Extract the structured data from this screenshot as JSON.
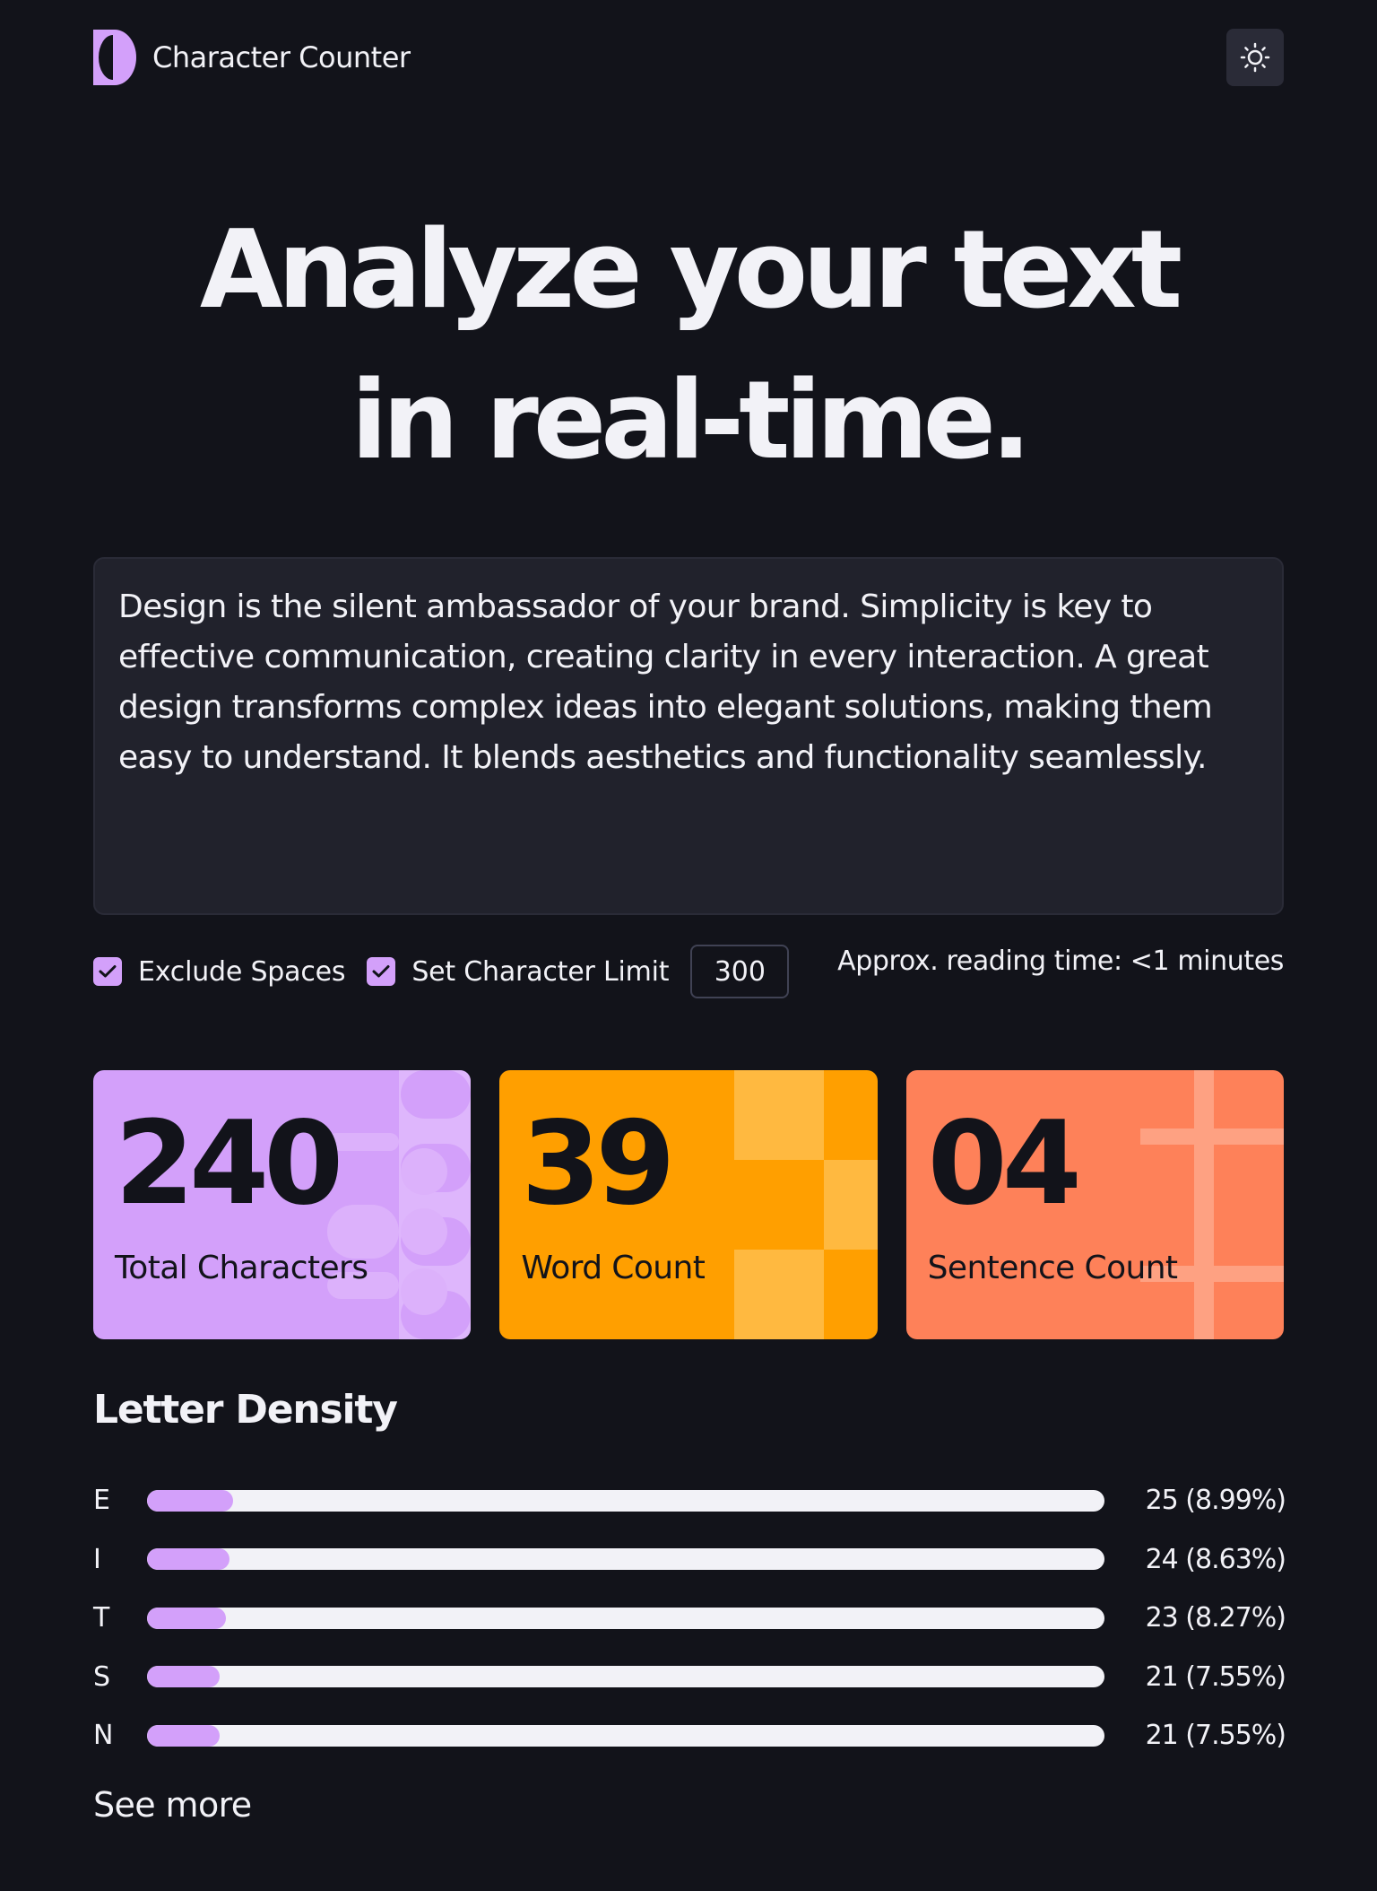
{
  "app": {
    "title": "Character Counter",
    "logo_icon": "half-circle-logo-icon",
    "theme_toggle_icon": "sun-icon"
  },
  "hero": {
    "line1": "Analyze your text",
    "line2": "in real-time."
  },
  "editor": {
    "text": "Design is the silent ambassador of your brand. Simplicity is key to effective communication, creating clarity in every interaction. A great design transforms complex ideas into elegant solutions, making them easy to understand. It blends aesthetics and functionality seamlessly."
  },
  "options": {
    "exclude_spaces": {
      "label": "Exclude Spaces",
      "checked": true
    },
    "char_limit": {
      "label": "Set Character Limit",
      "checked": true,
      "value": "300"
    },
    "reading_time": "Approx. reading time: <1 minutes"
  },
  "stats": [
    {
      "value": "240",
      "label": "Total Characters",
      "color": "#d3a0fa"
    },
    {
      "value": "39",
      "label": "Word Count",
      "color": "#ff9f00"
    },
    {
      "value": "04",
      "label": "Sentence Count",
      "color": "#fe8159"
    }
  ],
  "density": {
    "title": "Letter Density",
    "items": [
      {
        "letter": "E",
        "count": "25 (8.99%)",
        "percent": 8.99
      },
      {
        "letter": "I",
        "count": "24 (8.63%)",
        "percent": 8.63
      },
      {
        "letter": "T",
        "count": "23 (8.27%)",
        "percent": 8.27
      },
      {
        "letter": "S",
        "count": "21 (7.55%)",
        "percent": 7.55
      },
      {
        "letter": "N",
        "count": "21 (7.55%)",
        "percent": 7.55
      }
    ],
    "see_more": "See more"
  },
  "colors": {
    "background": "#12131a",
    "accent": "#d3a0fa",
    "text": "#f2f2f7"
  }
}
